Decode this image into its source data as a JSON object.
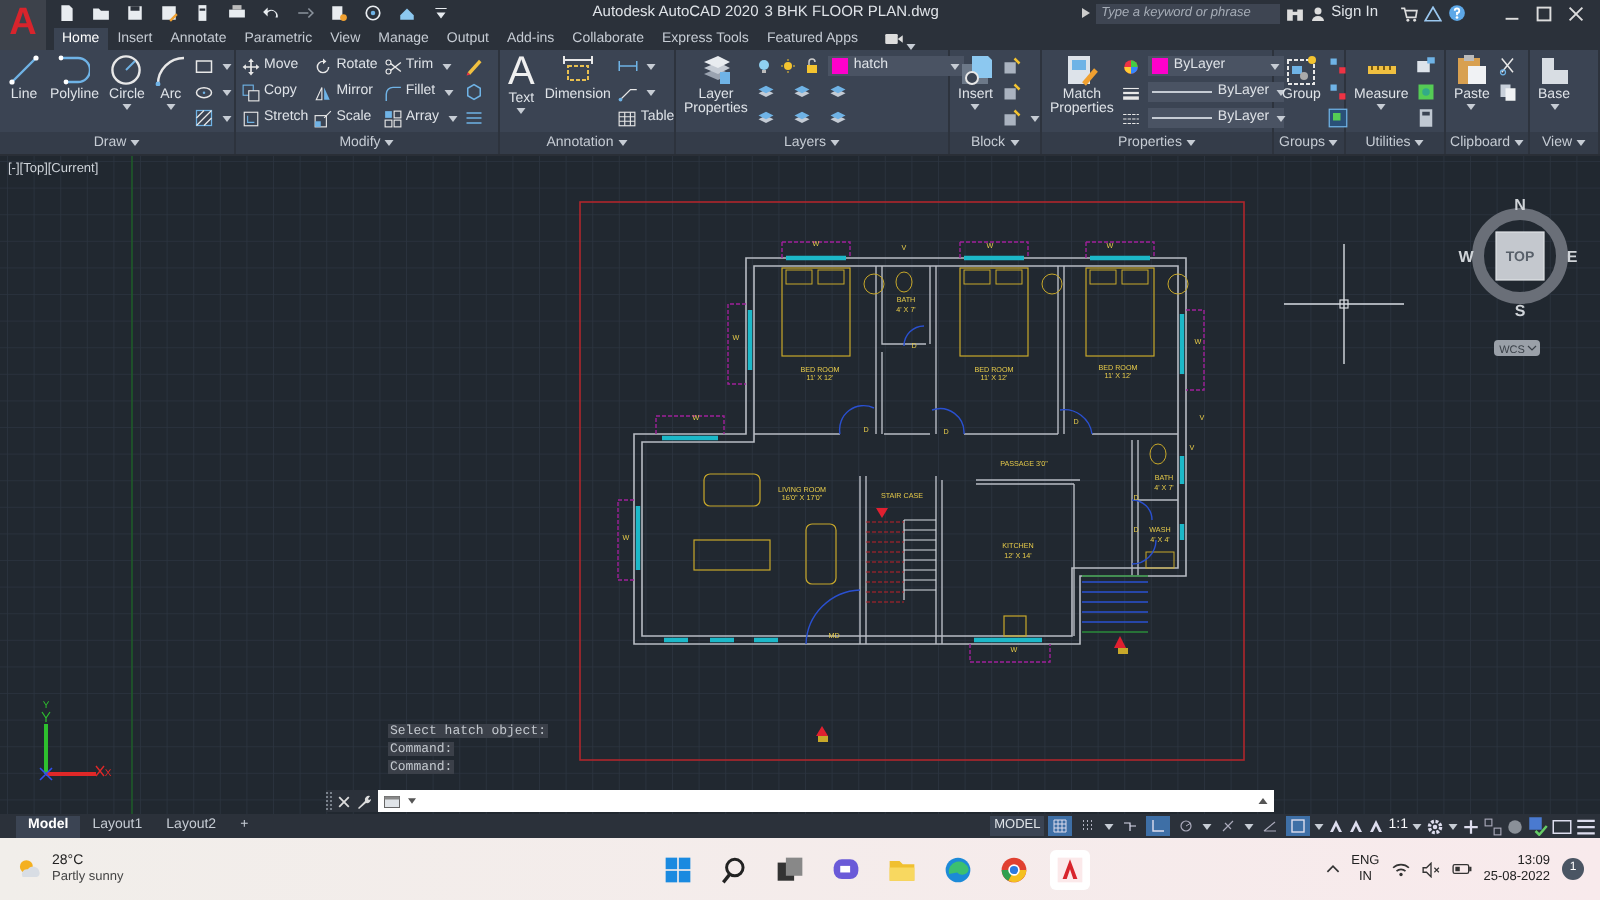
{
  "app_button": {
    "glyph": "A"
  },
  "title_bar": {
    "app_title": "Autodesk AutoCAD 2020",
    "document": "3 BHK FLOOR PLAN.dwg",
    "search_placeholder": "Type a keyword or phrase",
    "sign_in": "Sign In"
  },
  "ribbon_tabs": [
    {
      "label": "Home",
      "selected": true
    },
    {
      "label": "Insert",
      "selected": false
    },
    {
      "label": "Annotate",
      "selected": false
    },
    {
      "label": "Parametric",
      "selected": false
    },
    {
      "label": "View",
      "selected": false
    },
    {
      "label": "Manage",
      "selected": false
    },
    {
      "label": "Output",
      "selected": false
    },
    {
      "label": "Add-ins",
      "selected": false
    },
    {
      "label": "Collaborate",
      "selected": false
    },
    {
      "label": "Express Tools",
      "selected": false
    },
    {
      "label": "Featured Apps",
      "selected": false
    }
  ],
  "panels": [
    {
      "label": "Draw",
      "tools": [
        {
          "label": "Line"
        },
        {
          "label": "Polyline"
        },
        {
          "label": "Circle"
        },
        {
          "label": "Arc"
        }
      ]
    },
    {
      "label": "Modify",
      "tools": [
        {
          "label": "Move"
        },
        {
          "label": "Copy"
        },
        {
          "label": "Stretch"
        },
        {
          "label": "Rotate"
        },
        {
          "label": "Mirror"
        },
        {
          "label": "Scale"
        },
        {
          "label": "Trim"
        },
        {
          "label": "Fillet"
        },
        {
          "label": "Array"
        }
      ]
    },
    {
      "label": "Annotation",
      "tools": [
        {
          "label": "Text",
          "glyph": "A"
        },
        {
          "label": "Dimension"
        },
        {
          "label": "Table"
        }
      ]
    },
    {
      "label": "Layers",
      "tools": [
        {
          "label": "Layer Properties"
        }
      ],
      "dropdowns": [
        "hatch"
      ]
    },
    {
      "label": "Block",
      "tools": [
        {
          "label": "Insert"
        }
      ]
    },
    {
      "label": "Properties",
      "tools": [
        {
          "label": "Match Properties"
        }
      ],
      "dropdowns": [
        "ByLayer",
        "ByLayer",
        "ByLayer"
      ]
    },
    {
      "label": "Groups",
      "tools": [
        {
          "label": "Group"
        }
      ]
    },
    {
      "label": "Utilities",
      "tools": [
        {
          "label": "Measure"
        }
      ]
    },
    {
      "label": "Clipboard",
      "tools": [
        {
          "label": "Paste"
        }
      ]
    },
    {
      "label": "View",
      "tools": [
        {
          "label": "Base"
        }
      ]
    }
  ],
  "viewport_controls": [
    "[-]",
    "[Top]",
    "[Current]"
  ],
  "viewcube": {
    "face": "TOP",
    "north": "N",
    "south": "S",
    "east": "E",
    "west": "W",
    "ucs": "WCS"
  },
  "ucs_icon": {
    "x": "X",
    "y": "Y"
  },
  "plan_labels": [
    "W",
    "V",
    "W",
    "W",
    "BATH",
    "4' X 7'",
    "W",
    "D",
    "BED ROOM",
    "11' X 12'",
    "BED ROOM",
    "11' X 12'",
    "BED ROOM",
    "11' X 12'",
    "W",
    "W",
    "D",
    "D",
    "D",
    "V",
    "V",
    "PASSAGE 3'0\"",
    "LIVING ROOM",
    "16'0\" X 17'0\"",
    "STAIR CASE",
    "BATH",
    "4' X 7'",
    "D",
    "D",
    "WASH",
    "4' X 4'",
    "KITCHEN",
    "12' X 14'",
    "W",
    "MD",
    "W"
  ],
  "command_history": [
    "Select hatch object:",
    "Command:",
    "Command:"
  ],
  "layout_tabs": [
    {
      "label": "Model",
      "selected": true
    },
    {
      "label": "Layout1",
      "selected": false
    },
    {
      "label": "Layout2",
      "selected": false
    }
  ],
  "add_layout": "+",
  "status_bar": {
    "space": "MODEL",
    "scale": "1:1"
  },
  "status_toggles": [
    {
      "on": true
    },
    {
      "on": false
    },
    {
      "on": false
    },
    {
      "on": true
    },
    {
      "on": false
    },
    {
      "on": false
    },
    {
      "on": false
    },
    {
      "on": true
    }
  ],
  "taskbar": {
    "temperature": "28°C",
    "weather": "Partly sunny",
    "language": "ENG",
    "region": "IN",
    "time": "13:09",
    "date": "25-08-2022",
    "notifications": "1"
  }
}
